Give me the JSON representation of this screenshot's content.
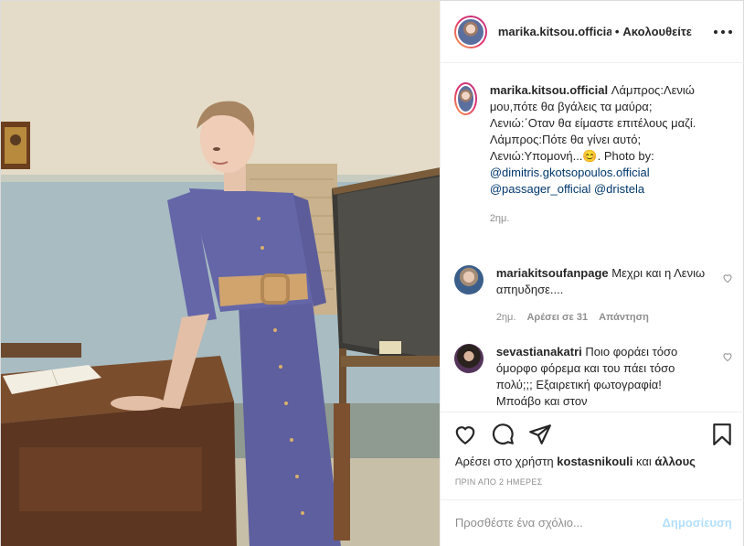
{
  "header": {
    "username": "marika.kitsou.official",
    "separator": "•",
    "follow_label": "Ακολουθείτε"
  },
  "caption": {
    "username": "marika.kitsou.official",
    "line1": "Λάμπρος:Λενιώ μου,πότε θα βγάλεις τα μαύρα;",
    "line2": "Λενιώ:΄Οταν θα είμαστε επιτέλους μαζί.",
    "line3": "Λάμπρος:Πότε θα γίνει αυτό;",
    "line4": "Λενιώ:Υπομονή...",
    "emoji": "😊",
    "photo_by": ". Photo by:",
    "mention1": "@dimitris.gkotsopoulos.official",
    "mention2": "@passager_official",
    "mention3": "@dristela",
    "time": "2ημ."
  },
  "comments": [
    {
      "username": "mariakitsoufanpage",
      "text": "Μεχρι και η Λενιω απηυδησε....",
      "time": "2ημ.",
      "likes": "Αρέσει σε 31",
      "reply": "Απάντηση"
    },
    {
      "username": "sevastianakatri",
      "text": "Ποιο φοράει τόσο όμορφο φόρεμα και του πάει τόσο πολύ;;; Εξαιρετική φωτογραφία! Μποάβο και στον"
    }
  ],
  "actions": {
    "icons": [
      "heart-icon",
      "comment-icon",
      "share-icon",
      "bookmark-icon"
    ],
    "likes_prefix": "Αρέσει στο χρήστη",
    "likes_user": "kostasnikouli",
    "likes_and": "και",
    "likes_others": "άλλους",
    "time": "ΠΡΙΝ ΑΠΟ 2 ΗΜΕΡΕΣ"
  },
  "add_comment": {
    "placeholder": "Προσθέστε ένα σχόλιο...",
    "post_label": "Δημοσίευση"
  },
  "colors": {
    "accent_link": "#00376b",
    "post_disabled": "#b2dffc",
    "dress": "#5e5f9e",
    "wall": "#d8d3c2"
  }
}
